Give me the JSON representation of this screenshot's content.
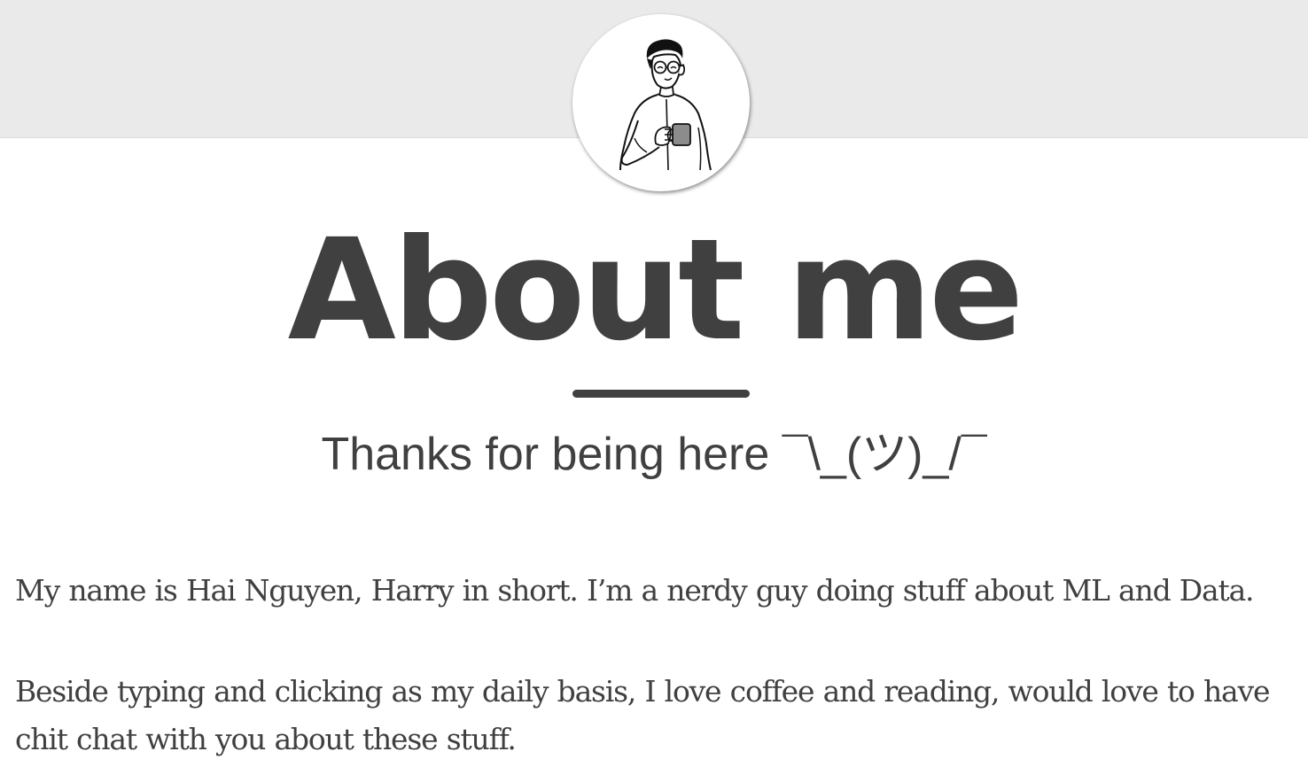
{
  "header": {
    "avatar_icon": "person-holding-coffee-mug-illustration",
    "band_color": "#eaeaea"
  },
  "main": {
    "title": "About me",
    "subtitle": "Thanks for being here ¯\\_(ツ)_/¯",
    "paragraphs": [
      "My name is Hai Nguyen, Harry in short. I’m a nerdy guy doing stuff about ML and Data.",
      "Beside typing and clicking as my daily basis, I love coffee and reading, would love to have chit chat with you about these stuff."
    ]
  },
  "colors": {
    "text": "#404040",
    "background": "#ffffff"
  }
}
